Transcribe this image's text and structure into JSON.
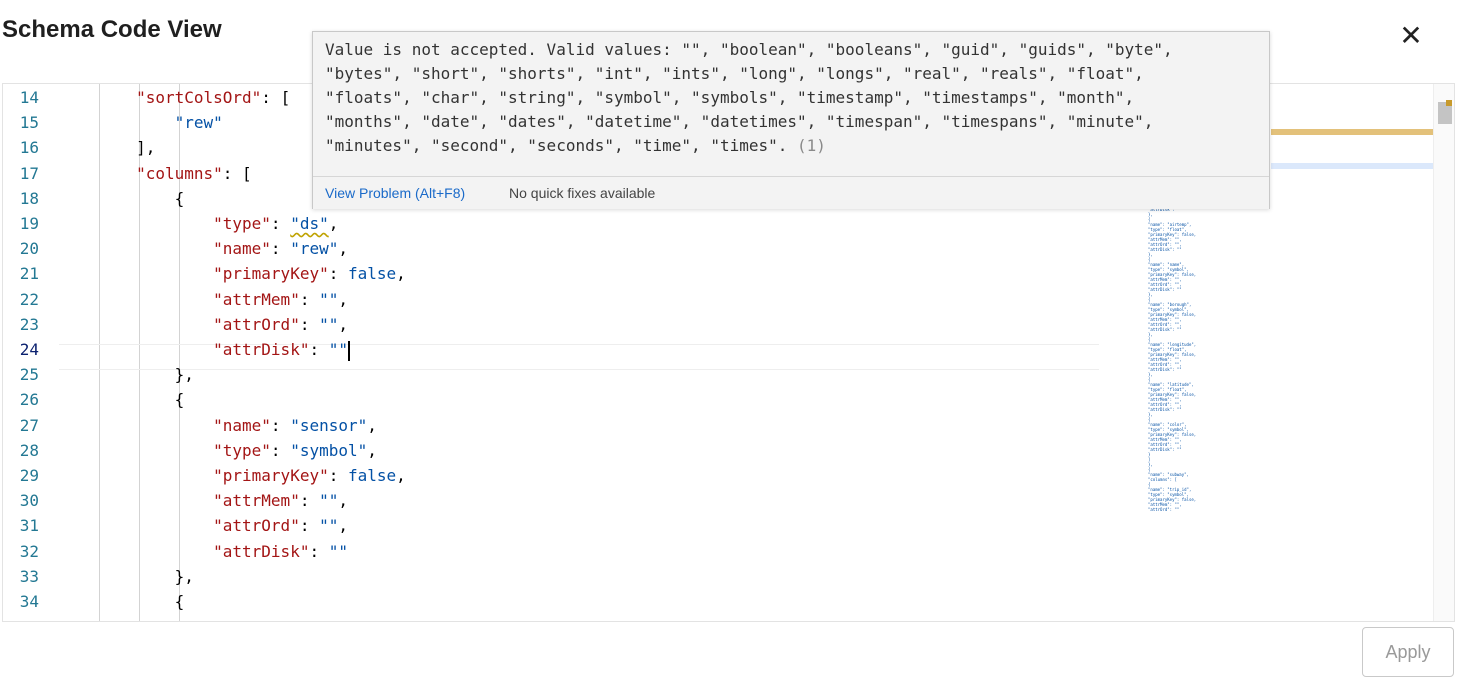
{
  "dialog": {
    "title": "Schema Code View",
    "close_icon": "close-icon",
    "apply_label": "Apply"
  },
  "editor": {
    "line_numbers": [
      "14",
      "15",
      "16",
      "17",
      "18",
      "19",
      "20",
      "21",
      "22",
      "23",
      "24",
      "25",
      "26",
      "27",
      "28",
      "29",
      "30",
      "31",
      "32",
      "33",
      "34"
    ],
    "active_line": "24",
    "lines": [
      "        \"sortColsOrd\": [",
      "            \"rew\"",
      "        ],",
      "        \"columns\": [",
      "            {",
      "                \"type\": \"ds\",",
      "                \"name\": \"rew\",",
      "                \"primaryKey\": false,",
      "                \"attrMem\": \"\",",
      "                \"attrOrd\": \"\",",
      "                \"attrDisk\": \"\"",
      "            },",
      "            {",
      "                \"name\": \"sensor\",",
      "                \"type\": \"symbol\",",
      "                \"primaryKey\": false,",
      "                \"attrMem\": \"\",",
      "                \"attrOrd\": \"\",",
      "                \"attrDisk\": \"\"",
      "            },",
      "            {"
    ]
  },
  "hover": {
    "message": "Value is not accepted. Valid values: \"\", \"boolean\", \"booleans\", \"guid\", \"guids\", \"byte\",\n\"bytes\", \"short\", \"shorts\", \"int\", \"ints\", \"long\", \"longs\", \"real\", \"reals\", \"float\",\n\"floats\", \"char\", \"string\", \"symbol\", \"symbols\", \"timestamp\", \"timestamps\", \"month\",\n\"months\", \"date\", \"dates\", \"datetime\", \"datetimes\", \"timespan\", \"timespans\", \"minute\",\n\"minutes\", \"second\", \"seconds\", \"time\", \"times\".",
    "count": "(1)",
    "view_problem": "View Problem (Alt+F8)",
    "no_fixes": "No quick fixes available"
  },
  "colors": {
    "key": "#a31515",
    "string": "#0451a5",
    "line_number": "#237893",
    "warning_squiggle": "#bfa200",
    "link": "#1a6ac9"
  }
}
